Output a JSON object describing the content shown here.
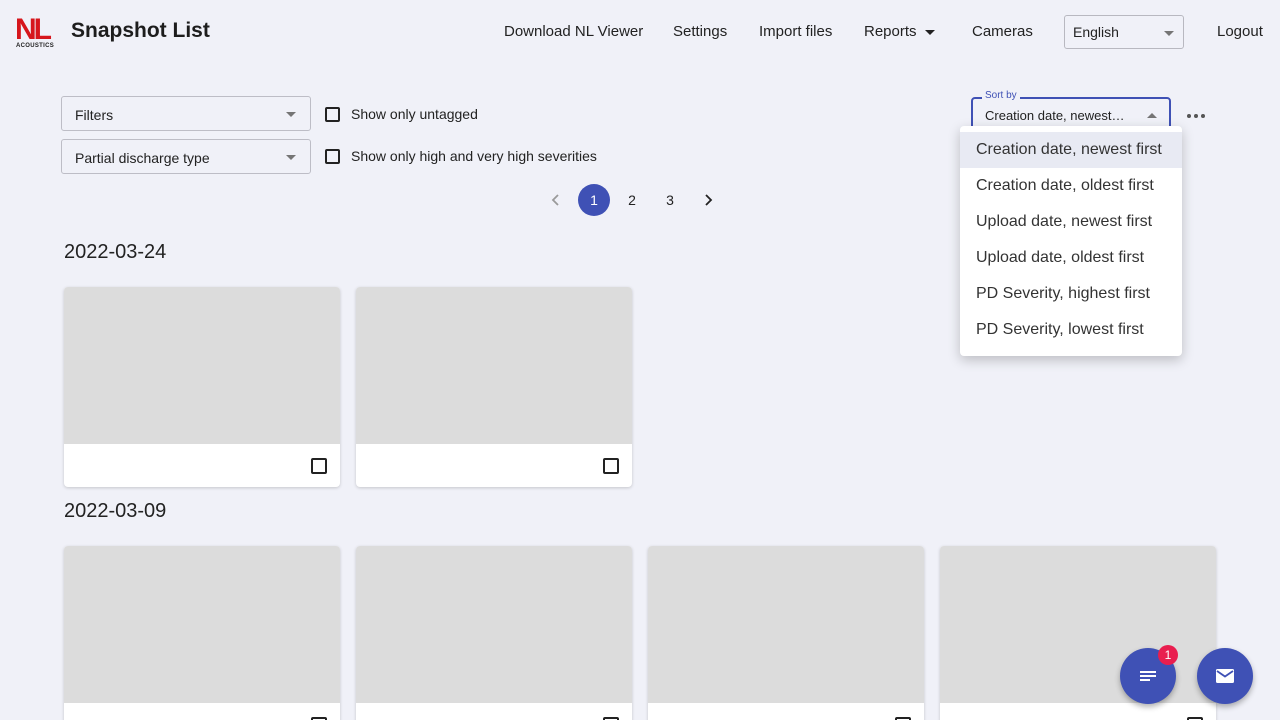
{
  "header": {
    "logo_text": "NL",
    "logo_subtext": "ACOUSTICS",
    "title": "Snapshot List",
    "nav": {
      "download_viewer": "Download NL Viewer",
      "settings": "Settings",
      "import_files": "Import files",
      "reports": "Reports",
      "cameras": "Cameras",
      "logout": "Logout"
    },
    "language": "English"
  },
  "filters": {
    "filters_select": "Filters",
    "pd_type_select": "Partial discharge type",
    "untagged_label": "Show only untagged",
    "untagged_checked": false,
    "severity_label": "Show only high and very high severities",
    "severity_checked": false
  },
  "pagination": {
    "pages": [
      "1",
      "2",
      "3"
    ],
    "current": "1"
  },
  "sort": {
    "label": "Sort by",
    "value": "Creation date, newest…",
    "options": [
      "Creation date, newest first",
      "Creation date, oldest first",
      "Upload date, newest first",
      "Upload date, oldest first",
      "PD Severity, highest first",
      "PD Severity, lowest first"
    ],
    "selected_index": 0
  },
  "groups": [
    {
      "date": "2022-03-24",
      "count": 2
    },
    {
      "date": "2022-03-09",
      "count": 4
    }
  ],
  "fab": {
    "badge": "1",
    "left_icon": "notes-icon",
    "right_icon": "mail-icon"
  },
  "colors": {
    "primary": "#3f51b5",
    "brand_red": "#d6161c",
    "badge": "#e91e4f",
    "background": "#f0f1f8"
  }
}
